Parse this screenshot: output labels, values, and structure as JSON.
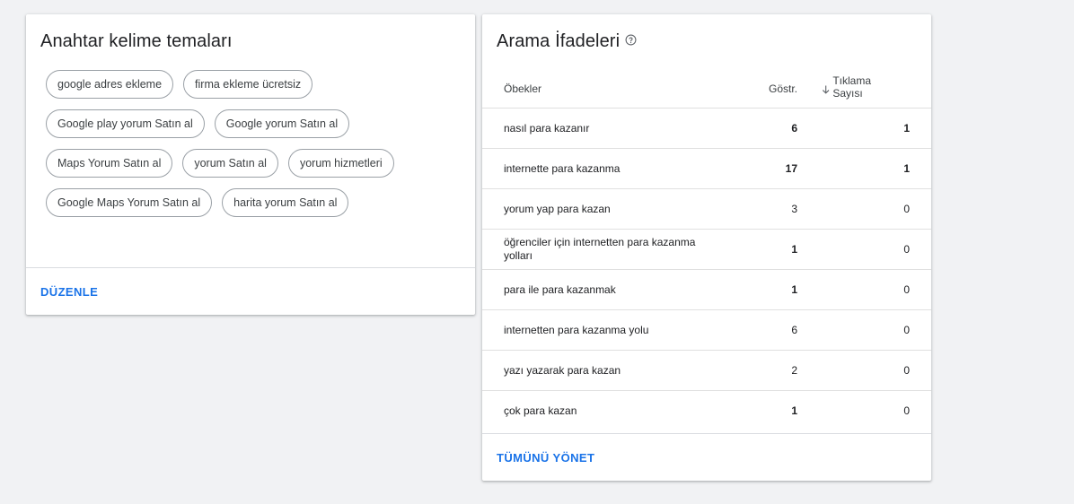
{
  "themes_card": {
    "title": "Anahtar kelime temaları",
    "chips": [
      "google adres ekleme",
      "firma ekleme ücretsiz",
      "Google play yorum Satın al",
      "Google yorum Satın al",
      "Maps Yorum Satın al",
      "yorum Satın al",
      "yorum hizmetleri",
      "Google Maps Yorum Satın al",
      "harita yorum Satın al"
    ],
    "edit_label": "DÜZENLE"
  },
  "search_card": {
    "title": "Arama İfadeleri",
    "help_icon": "help-circle-icon",
    "columns": {
      "name": "Öbekler",
      "impressions": "Göstr.",
      "clicks": "Tıklama Sayısı",
      "sort_icon": "arrow-down-icon"
    },
    "rows": [
      {
        "name": "nasıl para kazanır",
        "impressions": "6",
        "clicks": "1",
        "impr_bold": true,
        "clicks_bold": true
      },
      {
        "name": "internette para kazanma",
        "impressions": "17",
        "clicks": "1",
        "impr_bold": true,
        "clicks_bold": true
      },
      {
        "name": "yorum yap para kazan",
        "impressions": "3",
        "clicks": "0",
        "impr_bold": false,
        "clicks_bold": false
      },
      {
        "name": "öğrenciler için internetten para kazanma yolları",
        "impressions": "1",
        "clicks": "0",
        "impr_bold": true,
        "clicks_bold": false
      },
      {
        "name": "para ile para kazanmak",
        "impressions": "1",
        "clicks": "0",
        "impr_bold": true,
        "clicks_bold": false
      },
      {
        "name": "internetten para kazanma yolu",
        "impressions": "6",
        "clicks": "0",
        "impr_bold": false,
        "clicks_bold": false
      },
      {
        "name": "yazı yazarak para kazan",
        "impressions": "2",
        "clicks": "0",
        "impr_bold": false,
        "clicks_bold": false
      },
      {
        "name": "çok para kazan",
        "impressions": "1",
        "clicks": "0",
        "impr_bold": true,
        "clicks_bold": false
      }
    ],
    "manage_label": "TÜMÜNÜ YÖNET"
  },
  "colors": {
    "background": "#f1f2f4",
    "accent": "#1a73e8",
    "chip_border": "#9aa0a6"
  }
}
